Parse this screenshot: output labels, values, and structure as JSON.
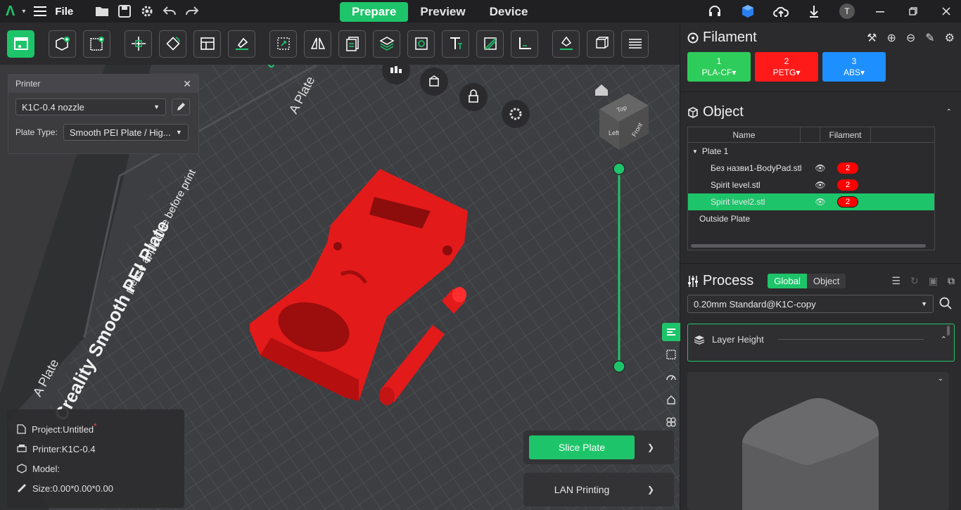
{
  "topbar": {
    "file_label": "File",
    "tabs": [
      "Prepare",
      "Preview",
      "Device"
    ],
    "user_initial": "T"
  },
  "printer_panel": {
    "title": "Printer",
    "printer_select": "K1C-0.4 nozzle",
    "plate_type_label": "Plate Type:",
    "plate_type_select": "Smooth PEI Plate / Hig..."
  },
  "bed": {
    "brand_text": "Creality Smooth PEI Plate",
    "note_text": "please apply glue before print",
    "corner_label_1": "A Plate",
    "corner_label_2": "A Plate",
    "plate_number": "01"
  },
  "viewcube": {
    "top": "Top",
    "left": "Left",
    "front": "Front"
  },
  "info": {
    "project": "Project:Untitled",
    "printer": "Printer:K1C-0.4",
    "model": "Model:",
    "size": "Size:0.00*0.00*0.00"
  },
  "actions": {
    "slice": "Slice Plate",
    "lan": "LAN Printing"
  },
  "filament": {
    "title": "Filament",
    "chips": [
      {
        "num": "1",
        "name": "PLA-CF",
        "color": "#2ecc5a"
      },
      {
        "num": "2",
        "name": "PETG",
        "color": "#ff1a1a"
      },
      {
        "num": "3",
        "name": "ABS",
        "color": "#1e8fff"
      }
    ]
  },
  "object": {
    "title": "Object",
    "col_name": "Name",
    "col_filament": "Filament",
    "plate": "Plate 1",
    "rows": [
      {
        "name": "Без назви1-BodyPad.stl",
        "filament": "2"
      },
      {
        "name": "Spirit level.stl",
        "filament": "2"
      },
      {
        "name": "Spirit level2.stl",
        "filament": "2"
      }
    ],
    "outside": "Outside Plate"
  },
  "process": {
    "title": "Process",
    "global": "Global",
    "object": "Object",
    "preset": "0.20mm Standard@K1C-copy",
    "layer_height_title": "Layer Height"
  }
}
